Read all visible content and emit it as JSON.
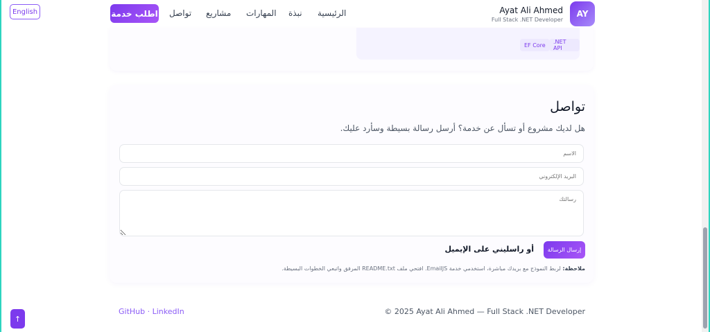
{
  "lang_toggle": "English",
  "header": {
    "cta": "اطلب خدمة",
    "nav": [
      "تواصل",
      "مشاريع",
      "المهارات",
      "نبذة",
      "الرئيسية"
    ],
    "brand_name": "Ayat Ali Ahmed",
    "brand_subtitle": "Full Stack .NET Developer",
    "logo": "AY"
  },
  "project": {
    "chips": [
      "EF Core",
      ".NET API"
    ]
  },
  "contact": {
    "title": "تواصل",
    "subtitle": "هل لديك مشروع أو تسأل عن خدمة؟ أرسل رسالة بسيطة وسأرد عليك.",
    "name_placeholder": "الاسم",
    "email_placeholder": "البريد الإلكتروني",
    "message_placeholder": "رسالتك",
    "send_button": "إرسال الرسالة",
    "email_link": "أو راسليني على الإيميل",
    "note_label": "ملاحظة:",
    "note_text": "لربط النموذج مع بريدك مباشرة، استخدمي خدمة EmailJS. افتحي ملف README.txt المرفق واتبعي الخطوات البسيطة."
  },
  "footer": {
    "links": "GitHub · LinkedIn",
    "copyright": "© 2025 Ayat Ali Ahmed — Full Stack .NET Developer"
  },
  "scroll_top": "↑",
  "colors": {
    "accent": "#7c3aed",
    "frame": "#2dd4bf"
  },
  "icons": {
    "scroll_top": "arrow-up-icon"
  }
}
